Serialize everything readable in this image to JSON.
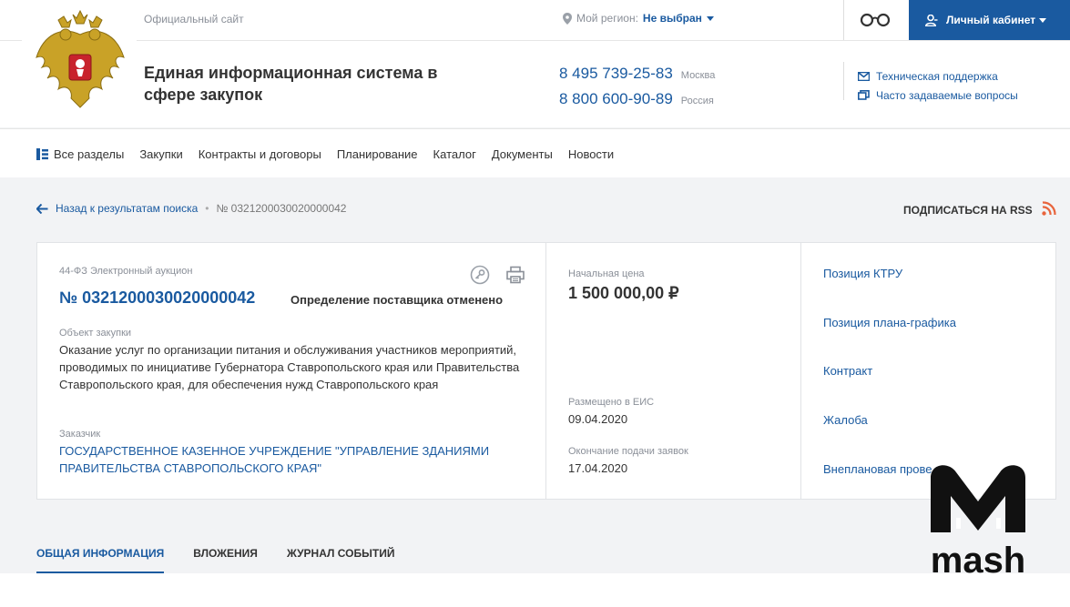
{
  "header": {
    "official_label": "Официальный сайт",
    "site_title": "Единая информационная система в сфере закупок",
    "region_label": "Мой регион:",
    "region_value": "Не выбран",
    "phones": [
      {
        "number": "8 495 739-25-83",
        "area": "Москва"
      },
      {
        "number": "8 800 600-90-89",
        "area": "Россия"
      }
    ],
    "support_links": [
      {
        "label": "Техническая поддержка",
        "icon": "mail-icon"
      },
      {
        "label": "Часто задаваемые вопросы",
        "icon": "faq-icon"
      }
    ],
    "cabinet_label": "Личный кабинет"
  },
  "nav": {
    "items": [
      "Все разделы",
      "Закупки",
      "Контракты и договоры",
      "Планирование",
      "Каталог",
      "Документы",
      "Новости"
    ]
  },
  "breadcrumb": {
    "back_label": "Назад к результатам поиска",
    "current": "№ 0321200030020000042"
  },
  "rss_label": "ПОДПИСАТЬСЯ НА RSS",
  "purchase": {
    "type": "44-ФЗ Электронный аукцион",
    "number": "№ 0321200030020000042",
    "status": "Определение поставщика отменено",
    "object_label": "Объект закупки",
    "object_text": "Оказание услуг по организации питания и обслуживания участников мероприятий, проводимых по инициативе Губернатора Ставропольского края или Правительства Ставропольского края, для обеспечения нужд Ставропольского края",
    "customer_label": "Заказчик",
    "customer_text": "ГОСУДАРСТВЕННОЕ КАЗЕННОЕ УЧРЕЖДЕНИЕ \"УПРАВЛЕНИЕ ЗДАНИЯМИ ПРАВИТЕЛЬСТВА СТАВРОПОЛЬСКОГО КРАЯ\"",
    "price_label": "Начальная цена",
    "price": "1 500 000,00 ₽",
    "posted_label": "Размещено в ЕИС",
    "posted": "09.04.2020",
    "end_label": "Окончание подачи заявок",
    "end": "17.04.2020"
  },
  "side_links": [
    "Позиция КТРУ",
    "Позиция плана-графика",
    "Контракт",
    "Жалоба",
    "Внеплановая прове"
  ],
  "tabs": [
    "ОБЩАЯ ИНФОРМАЦИЯ",
    "ВЛОЖЕНИЯ",
    "ЖУРНАЛ СОБЫТИЙ"
  ],
  "watermark": "mash",
  "colors": {
    "accent": "#1a5aa0",
    "rss": "#e8643c"
  }
}
